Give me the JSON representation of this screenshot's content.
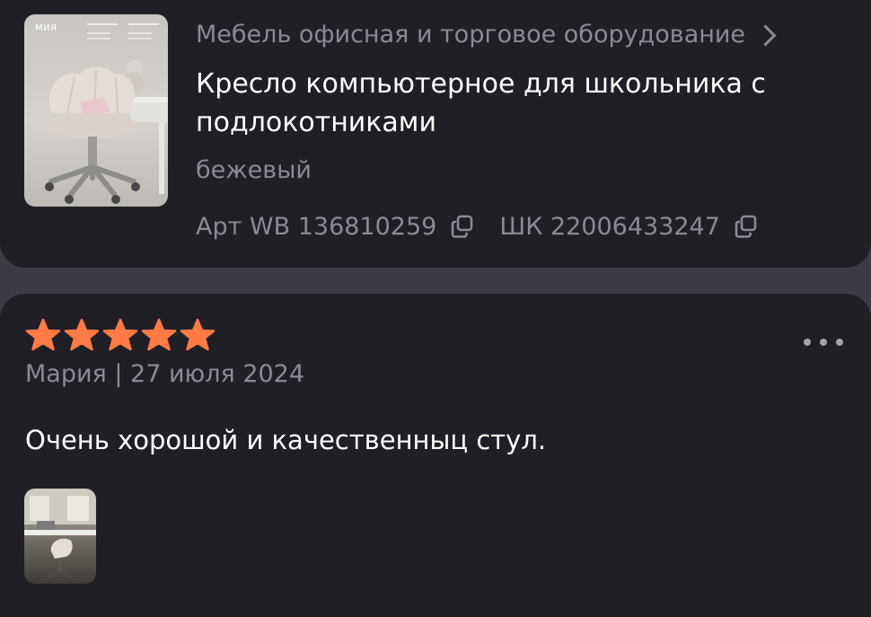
{
  "product": {
    "category": "Мебель офисная и торговое оборудование",
    "title": "Кресло компьютерное для школьника с подлокотниками",
    "color": "бежевый",
    "thumb_brand": "МИЯ",
    "art_label": "Арт WB 136810259",
    "barcode_label": "ШК 22006433247"
  },
  "review": {
    "rating": 5,
    "rating_max": 5,
    "author_date": "Мария | 27 июля 2024",
    "text": "Очень хорошой и качественныц стул.",
    "photos_count": 1
  },
  "colors": {
    "background": "#3d3b43",
    "card": "#211f26",
    "star": "#ff7a45",
    "muted_text": "#8d8994",
    "text": "#ffffff"
  },
  "icons": {
    "category_chevron": "chevron-right-icon",
    "copy": "copy-icon",
    "star": "star-icon",
    "more": "more-dots-icon"
  }
}
